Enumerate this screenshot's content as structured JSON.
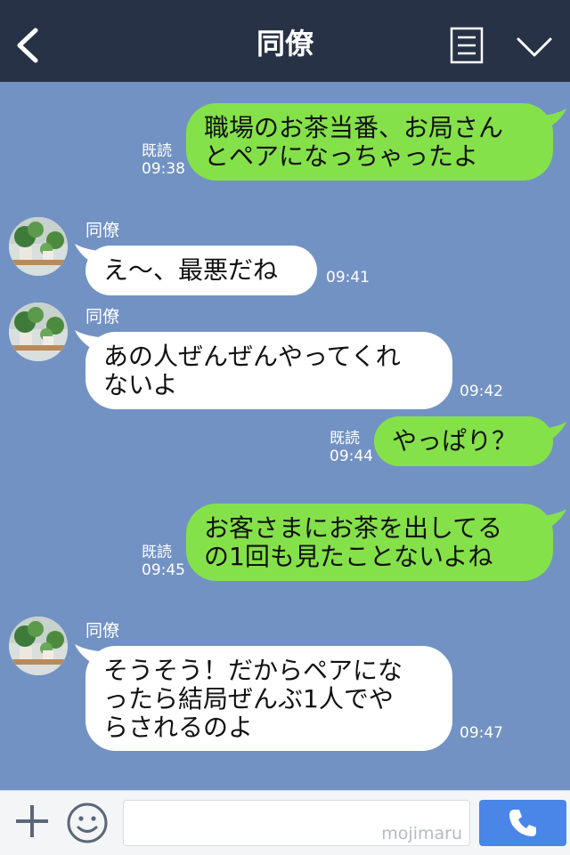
{
  "header": {
    "title": "同僚",
    "icons": {
      "back": "chevron-left-icon",
      "menu": "menu-list-icon",
      "collapse": "chevron-down-icon"
    }
  },
  "messages": [
    {
      "direction": "out",
      "text": "職場のお茶当番、お局さん\nとペアになっちゃったよ",
      "read": "既読",
      "time": "09:38"
    },
    {
      "direction": "in",
      "sender": "同僚",
      "text": "え〜、最悪だね",
      "time": "09:41"
    },
    {
      "direction": "in",
      "sender": "同僚",
      "text": "あの人ぜんぜんやってくれ\nないよ",
      "time": "09:42"
    },
    {
      "direction": "out",
      "text": "やっぱり？",
      "read": "既読",
      "time": "09:44"
    },
    {
      "direction": "out",
      "text": "お客さまにお茶を出してる\nの1回も見たことないよね",
      "read": "既読",
      "time": "09:45"
    },
    {
      "direction": "in",
      "sender": "同僚",
      "text": "そうそう！だからペアにな\nったら結局ぜんぶ1人でや\nらされるのよ",
      "time": "09:47"
    }
  ],
  "footer": {
    "watermark": "mojimaru",
    "icons": {
      "plus": "plus-icon",
      "emoji": "smile-icon",
      "call": "phone-icon"
    }
  },
  "colors": {
    "header_bg": "#273246",
    "chat_bg": "#7292c3",
    "outgoing_bubble": "#85e14a",
    "incoming_bubble": "#ffffff",
    "call_button": "#4a86e8"
  }
}
